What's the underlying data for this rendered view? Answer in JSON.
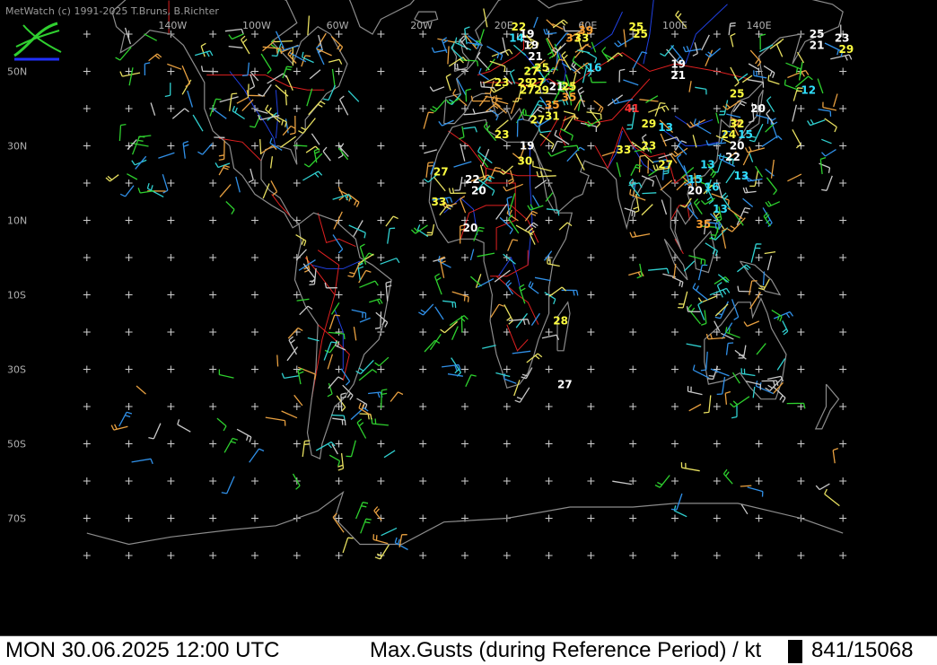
{
  "credit": "MetWatch  (c) 1991-2025 T.Bruns, B.Richter",
  "status": {
    "datetime": "MON 30.06.2025 12:00 UTC",
    "parameter": "Max.Gusts (during Reference Period) / kt",
    "count": "841/15068"
  },
  "colors": {
    "background": "#000000",
    "coast": "#8c8c8c",
    "borders": "#e02020",
    "rivers": "#2040e0",
    "grid": "#d0d0d0",
    "barb_palette": [
      "#2ed02e",
      "#3090e8",
      "#c8c8c8",
      "#30d0d0",
      "#e8e060",
      "#e8a040"
    ],
    "label_colors": {
      "white": "#ffffff",
      "yellow": "#ffff40",
      "cyan": "#30e0ff",
      "orange": "#ffa030",
      "red": "#ff3030"
    }
  },
  "axis_labels": {
    "lon": [
      "140W",
      "100W",
      "60W",
      "20W",
      "20E",
      "60E",
      "100E",
      "140E"
    ],
    "lat": [
      "50N",
      "30N",
      "10N",
      "10S",
      "30S",
      "50S",
      "70S"
    ]
  },
  "gust_labels": [
    {
      "text": "22",
      "lon": 22,
      "lat": 61,
      "color": "yellow"
    },
    {
      "text": "19",
      "lon": 26,
      "lat": 59,
      "color": "white"
    },
    {
      "text": "14",
      "lon": 21,
      "lat": 58,
      "color": "cyan"
    },
    {
      "text": "39",
      "lon": 54,
      "lat": 60,
      "color": "orange"
    },
    {
      "text": "37",
      "lon": 48,
      "lat": 58,
      "color": "orange"
    },
    {
      "text": "33",
      "lon": 52,
      "lat": 58,
      "color": "yellow"
    },
    {
      "text": "25",
      "lon": 78,
      "lat": 61,
      "color": "yellow"
    },
    {
      "text": "25",
      "lon": 80,
      "lat": 59,
      "color": "yellow"
    },
    {
      "text": "19",
      "lon": 28,
      "lat": 56,
      "color": "white"
    },
    {
      "text": "21",
      "lon": 30,
      "lat": 53,
      "color": "white"
    },
    {
      "text": "16",
      "lon": 58,
      "lat": 50,
      "color": "cyan"
    },
    {
      "text": "19",
      "lon": 98,
      "lat": 51,
      "color": "white"
    },
    {
      "text": "21",
      "lon": 98,
      "lat": 48,
      "color": "white"
    },
    {
      "text": "25",
      "lon": 33,
      "lat": 50,
      "color": "yellow"
    },
    {
      "text": "27",
      "lon": 28,
      "lat": 49,
      "color": "yellow"
    },
    {
      "text": "29",
      "lon": 25,
      "lat": 46,
      "color": "yellow"
    },
    {
      "text": "27",
      "lon": 31,
      "lat": 46,
      "color": "yellow"
    },
    {
      "text": "27",
      "lon": 26,
      "lat": 44,
      "color": "yellow"
    },
    {
      "text": "29",
      "lon": 33,
      "lat": 44,
      "color": "yellow"
    },
    {
      "text": "21",
      "lon": 40,
      "lat": 45,
      "color": "white"
    },
    {
      "text": "25",
      "lon": 46,
      "lat": 45,
      "color": "yellow"
    },
    {
      "text": "23",
      "lon": 14,
      "lat": 46,
      "color": "yellow"
    },
    {
      "text": "35",
      "lon": 38,
      "lat": 40,
      "color": "orange"
    },
    {
      "text": "35",
      "lon": 46,
      "lat": 42,
      "color": "orange"
    },
    {
      "text": "31",
      "lon": 38,
      "lat": 37,
      "color": "yellow"
    },
    {
      "text": "27",
      "lon": 31,
      "lat": 36,
      "color": "yellow"
    },
    {
      "text": "41",
      "lon": 76,
      "lat": 39,
      "color": "red"
    },
    {
      "text": "29",
      "lon": 84,
      "lat": 35,
      "color": "yellow"
    },
    {
      "text": "13",
      "lon": 92,
      "lat": 34,
      "color": "cyan"
    },
    {
      "text": "25",
      "lon": 126,
      "lat": 43,
      "color": "yellow"
    },
    {
      "text": "12",
      "lon": 160,
      "lat": 44,
      "color": "cyan"
    },
    {
      "text": "20",
      "lon": 136,
      "lat": 39,
      "color": "white"
    },
    {
      "text": "32",
      "lon": 126,
      "lat": 35,
      "color": "yellow"
    },
    {
      "text": "24",
      "lon": 122,
      "lat": 32,
      "color": "yellow"
    },
    {
      "text": "15",
      "lon": 130,
      "lat": 32,
      "color": "cyan"
    },
    {
      "text": "20",
      "lon": 126,
      "lat": 29,
      "color": "white"
    },
    {
      "text": "22",
      "lon": 124,
      "lat": 26,
      "color": "white"
    },
    {
      "text": "13",
      "lon": 112,
      "lat": 24,
      "color": "cyan"
    },
    {
      "text": "13",
      "lon": 128,
      "lat": 21,
      "color": "cyan"
    },
    {
      "text": "15",
      "lon": 106,
      "lat": 20,
      "color": "cyan"
    },
    {
      "text": "16",
      "lon": 114,
      "lat": 18,
      "color": "cyan"
    },
    {
      "text": "20",
      "lon": 106,
      "lat": 17,
      "color": "white"
    },
    {
      "text": "13",
      "lon": 118,
      "lat": 12,
      "color": "cyan"
    },
    {
      "text": "35",
      "lon": 110,
      "lat": 8,
      "color": "orange"
    },
    {
      "text": "27",
      "lon": 92,
      "lat": 24,
      "color": "yellow"
    },
    {
      "text": "23",
      "lon": 14,
      "lat": 32,
      "color": "yellow"
    },
    {
      "text": "19",
      "lon": 26,
      "lat": 29,
      "color": "white"
    },
    {
      "text": "30",
      "lon": 25,
      "lat": 25,
      "color": "yellow"
    },
    {
      "text": "33",
      "lon": 72,
      "lat": 28,
      "color": "yellow"
    },
    {
      "text": "23",
      "lon": 84,
      "lat": 29,
      "color": "yellow"
    },
    {
      "text": "27",
      "lon": -15,
      "lat": 22,
      "color": "yellow"
    },
    {
      "text": "22",
      "lon": 0,
      "lat": 20,
      "color": "white"
    },
    {
      "text": "20",
      "lon": 3,
      "lat": 17,
      "color": "white"
    },
    {
      "text": "33",
      "lon": -16,
      "lat": 14,
      "color": "yellow"
    },
    {
      "text": "20",
      "lon": -1,
      "lat": 7,
      "color": "white"
    },
    {
      "text": "28",
      "lon": 42,
      "lat": -18,
      "color": "yellow"
    },
    {
      "text": "27",
      "lon": 44,
      "lat": -35,
      "color": "white"
    },
    {
      "text": "25",
      "lon": 164,
      "lat": 59,
      "color": "white"
    },
    {
      "text": "23",
      "lon": 176,
      "lat": 58,
      "color": "white"
    },
    {
      "text": "21",
      "lon": 164,
      "lat": 56,
      "color": "white"
    },
    {
      "text": "29",
      "lon": 178,
      "lat": 55,
      "color": "yellow"
    }
  ]
}
